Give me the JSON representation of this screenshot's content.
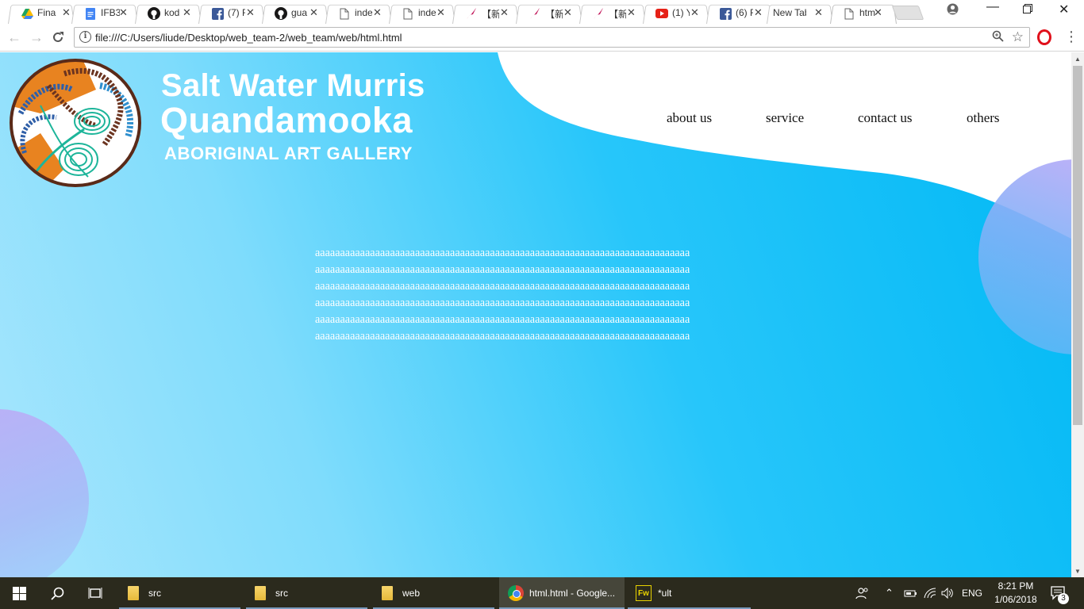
{
  "browser": {
    "tabs": [
      {
        "title": "Fina",
        "icon": "google-drive-icon"
      },
      {
        "title": "IFB3",
        "icon": "google-docs-icon"
      },
      {
        "title": "kod",
        "icon": "github-icon"
      },
      {
        "title": "(7) F",
        "icon": "facebook-icon"
      },
      {
        "title": "gua",
        "icon": "github-icon"
      },
      {
        "title": "inde",
        "icon": "page-icon"
      },
      {
        "title": "inde",
        "icon": "page-icon"
      },
      {
        "title": "【新",
        "icon": "feather-icon"
      },
      {
        "title": "【新",
        "icon": "feather-icon"
      },
      {
        "title": "【新",
        "icon": "feather-icon"
      },
      {
        "title": "(1) Y",
        "icon": "youtube-icon"
      },
      {
        "title": "(6) F",
        "icon": "facebook-icon"
      },
      {
        "title": "New Tab",
        "icon": ""
      },
      {
        "title": "htm",
        "icon": "page-icon",
        "active": true
      }
    ],
    "close_glyph": "✕",
    "address": "file:///C:/Users/liude/Desktop/web_team-2/web_team/web/html.html"
  },
  "page": {
    "brand": {
      "line1": "Salt Water Murris",
      "line2": "Quandamooka",
      "line3": "ABORIGINAL ART GALLERY"
    },
    "nav": {
      "about": "about us",
      "service": "service",
      "contact": "contact us",
      "others": "others"
    },
    "body_lines": [
      "aaaaaaaaaaaaaaaaaaaaaaaaaaaaaaaaaaaaaaaaaaaaaaaaaaaaaaaaaaaaaaaaaaaaaaaaaaa",
      "aaaaaaaaaaaaaaaaaaaaaaaaaaaaaaaaaaaaaaaaaaaaaaaaaaaaaaaaaaaaaaaaaaaaaaaaaaa",
      "aaaaaaaaaaaaaaaaaaaaaaaaaaaaaaaaaaaaaaaaaaaaaaaaaaaaaaaaaaaaaaaaaaaaaaaaaaa",
      "aaaaaaaaaaaaaaaaaaaaaaaaaaaaaaaaaaaaaaaaaaaaaaaaaaaaaaaaaaaaaaaaaaaaaaaaaaa",
      "aaaaaaaaaaaaaaaaaaaaaaaaaaaaaaaaaaaaaaaaaaaaaaaaaaaaaaaaaaaaaaaaaaaaaaaaaaa",
      "aaaaaaaaaaaaaaaaaaaaaaaaaaaaaaaaaaaaaaaaaaaaaaaaaaaaaaaaaaaaaaaaaaaaaaaaaaa"
    ],
    "colors": {
      "gradient_start": "#00b8f5",
      "gradient_end": "#a8e6fd",
      "accent_circle": "#c4a6f8"
    }
  },
  "taskbar": {
    "apps": [
      {
        "label": "src",
        "icon": "folder-icon"
      },
      {
        "label": "src",
        "icon": "folder-icon"
      },
      {
        "label": "web",
        "icon": "folder-icon"
      },
      {
        "label": "html.html - Google...",
        "icon": "chrome-icon",
        "active": true
      },
      {
        "label": "*ult",
        "icon": "fireworks-icon"
      }
    ],
    "fw_glyph": "Fw",
    "lang": "ENG",
    "time": "8:21 PM",
    "date": "1/06/2018",
    "notifications": "3"
  }
}
